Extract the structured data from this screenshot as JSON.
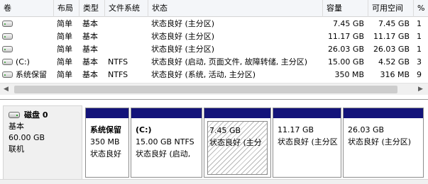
{
  "volume_list": {
    "columns": {
      "volume": "卷",
      "layout": "布局",
      "type": "类型",
      "filesystem": "文件系统",
      "status": "状态",
      "capacity": "容量",
      "free": "可用空间",
      "percent_free": "%"
    },
    "rows": [
      {
        "volume": "",
        "layout": "简单",
        "type": "基本",
        "filesystem": "",
        "status": "状态良好 (主分区)",
        "capacity": "7.45 GB",
        "free": "7.45 GB",
        "percent_free": "1"
      },
      {
        "volume": "",
        "layout": "简单",
        "type": "基本",
        "filesystem": "",
        "status": "状态良好 (主分区)",
        "capacity": "11.17 GB",
        "free": "11.17 GB",
        "percent_free": "1"
      },
      {
        "volume": "",
        "layout": "简单",
        "type": "基本",
        "filesystem": "",
        "status": "状态良好 (主分区)",
        "capacity": "26.03 GB",
        "free": "26.03 GB",
        "percent_free": "1"
      },
      {
        "volume": "(C:)",
        "layout": "简单",
        "type": "基本",
        "filesystem": "NTFS",
        "status": "状态良好 (启动, 页面文件, 故障转储, 主分区)",
        "capacity": "15.00 GB",
        "free": "4.52 GB",
        "percent_free": "3"
      },
      {
        "volume": "系统保留",
        "layout": "简单",
        "type": "基本",
        "filesystem": "NTFS",
        "status": "状态良好 (系统, 活动, 主分区)",
        "capacity": "350 MB",
        "free": "316 MB",
        "percent_free": "9"
      }
    ]
  },
  "scrollbar": {
    "left_arrow": "◀",
    "right_arrow": "▶"
  },
  "disk": {
    "title": "磁盘 0",
    "type": "基本",
    "size": "60.00 GB",
    "state": "联机",
    "partitions": [
      {
        "name": "系统保留",
        "size": "350 MB",
        "status": "状态良好",
        "selected": false
      },
      {
        "name": "(C:)",
        "size": "15.00 GB NTFS",
        "status": "状态良好 (启动,",
        "selected": false
      },
      {
        "name": "",
        "size": "7.45 GB",
        "status": "状态良好 (主分",
        "selected": true
      },
      {
        "name": "",
        "size": "11.17 GB",
        "status": "状态良好 (主分区)",
        "selected": false
      },
      {
        "name": "",
        "size": "26.03 GB",
        "status": "状态良好 (主分区)",
        "selected": false
      }
    ]
  },
  "colors": {
    "partition_bar": "#13137a",
    "header_bg": "#f4f6f9"
  }
}
